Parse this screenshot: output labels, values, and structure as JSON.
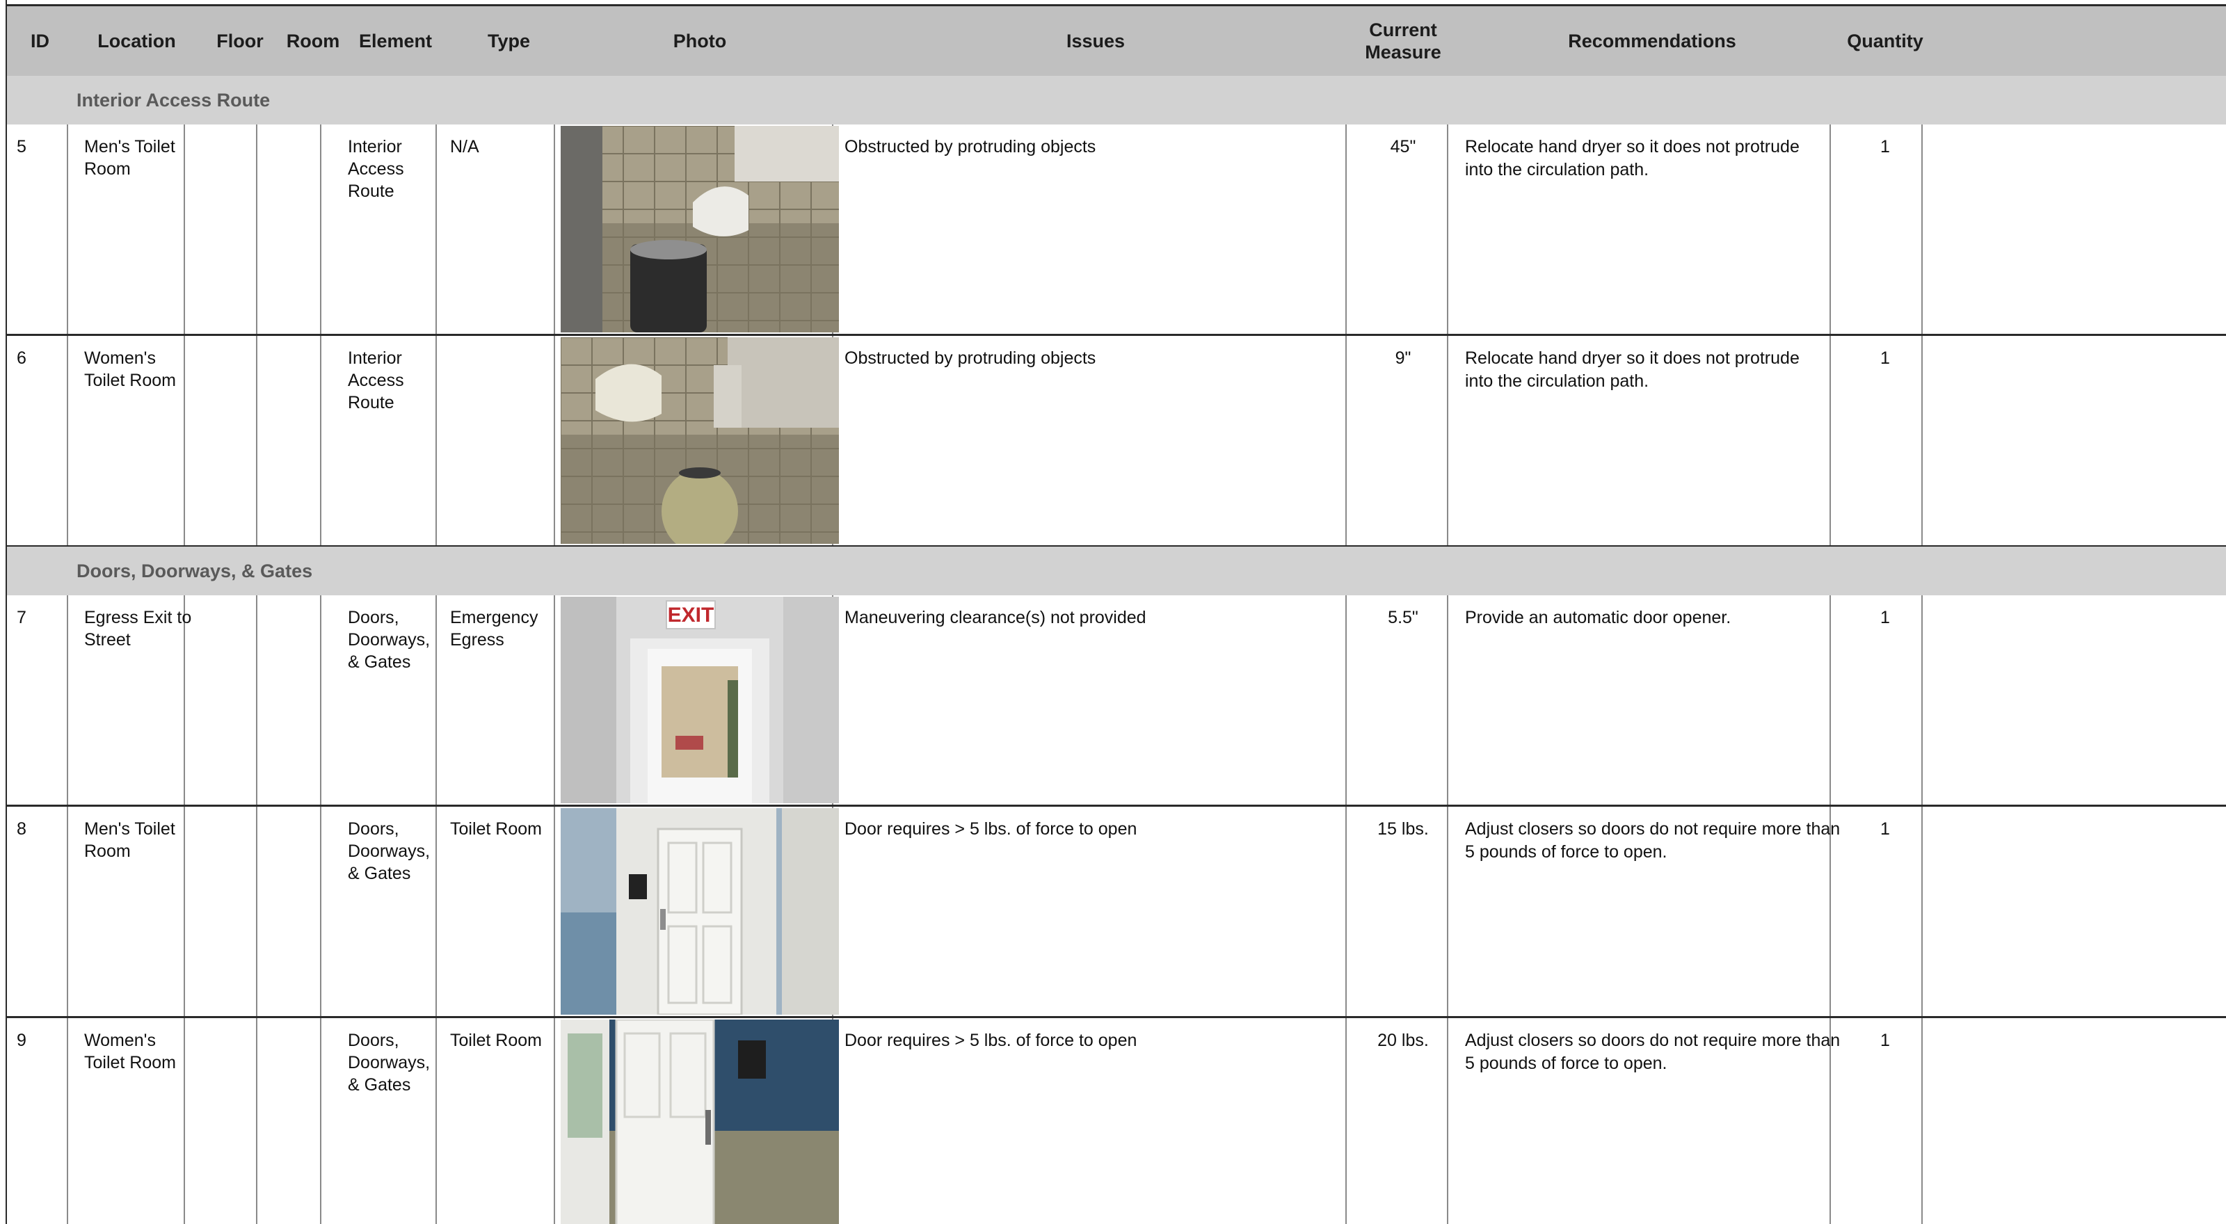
{
  "header": {
    "columns": {
      "id": "ID",
      "location": "Location",
      "floor": "Floor",
      "room": "Room",
      "element": "Element",
      "type": "Type",
      "photo": "Photo",
      "issues": "Issues",
      "current_measure_line1": "Current",
      "current_measure_line2": "Measure",
      "recommendations": "Recommendations",
      "quantity": "Quantity"
    }
  },
  "sections": [
    {
      "title": "Interior Access Route",
      "rows": [
        {
          "id": "5",
          "location": [
            "Men's Toilet",
            "Room"
          ],
          "floor": "",
          "room": "",
          "element": [
            "Interior",
            "Access",
            "Route"
          ],
          "type": [
            "N/A"
          ],
          "photo_icon": "hand-dryer-photo",
          "issue": "Obstructed by protruding objects",
          "measure": "45\"",
          "recommendation": [
            "Relocate hand dryer so it does not protrude",
            "into the circulation path."
          ],
          "quantity": "1"
        },
        {
          "id": "6",
          "location": [
            "Women's",
            "Toilet Room"
          ],
          "floor": "",
          "room": "",
          "element": [
            "Interior",
            "Access",
            "Route"
          ],
          "type": [],
          "photo_icon": "hand-dryer-photo",
          "issue": "Obstructed by protruding objects",
          "measure": "9\"",
          "recommendation": [
            "Relocate hand dryer so it does not protrude",
            "into the circulation path."
          ],
          "quantity": "1"
        }
      ]
    },
    {
      "title": "Doors, Doorways, & Gates",
      "rows": [
        {
          "id": "7",
          "location": [
            "Egress Exit to",
            "Street"
          ],
          "floor": "",
          "room": "",
          "element": [
            "Doors,",
            "Doorways,",
            "& Gates"
          ],
          "type": [
            "Emergency",
            "Egress"
          ],
          "photo_icon": "exit-door-photo",
          "exit_sign": "EXIT",
          "issue": "Maneuvering clearance(s) not provided",
          "measure": "5.5\"",
          "recommendation": [
            "Provide an automatic door opener."
          ],
          "quantity": "1"
        },
        {
          "id": "8",
          "location": [
            "Men's Toilet",
            "Room"
          ],
          "floor": "",
          "room": "",
          "element": [
            "Doors,",
            "Doorways,",
            "& Gates"
          ],
          "type": [
            "Toilet Room"
          ],
          "photo_icon": "toilet-door-photo",
          "issue": "Door requires > 5 lbs. of force to open",
          "measure": "15 lbs.",
          "recommendation": [
            "Adjust closers so doors do not require more than",
            "5 pounds of force to open."
          ],
          "quantity": "1"
        },
        {
          "id": "9",
          "location": [
            "Women's",
            "Toilet Room"
          ],
          "floor": "",
          "room": "",
          "element": [
            "Doors,",
            "Doorways,",
            "& Gates"
          ],
          "type": [
            "Toilet Room"
          ],
          "photo_icon": "toilet-door-photo",
          "issue": "Door requires > 5 lbs. of force to open",
          "measure": "20 lbs.",
          "recommendation": [
            "Adjust closers so doors do not require more than",
            "5 pounds of force to open."
          ],
          "quantity": "1"
        }
      ]
    }
  ]
}
